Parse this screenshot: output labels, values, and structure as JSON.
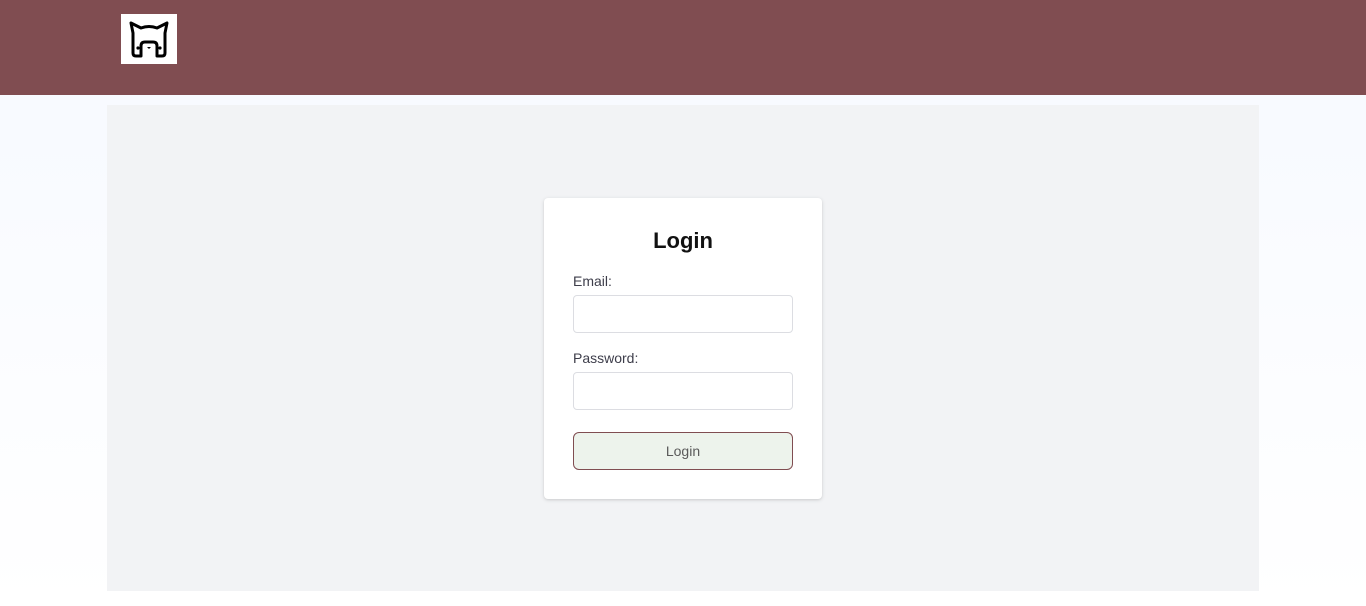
{
  "header": {
    "logo_icon": "cat-logo-icon",
    "background_color": "#804d51"
  },
  "login": {
    "title": "Login",
    "email_label": "Email:",
    "email_value": "",
    "password_label": "Password:",
    "password_value": "",
    "submit_label": "Login",
    "button_background": "#edf3ec"
  }
}
